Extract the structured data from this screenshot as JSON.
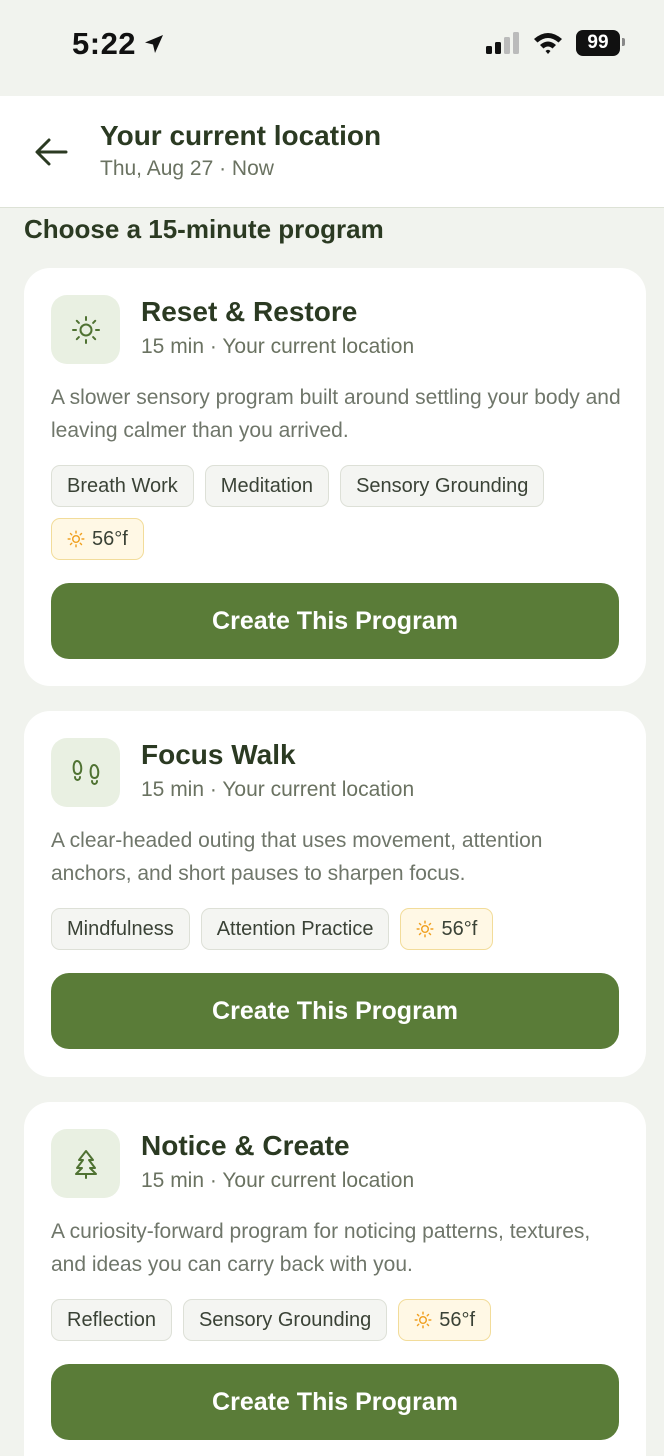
{
  "status_bar": {
    "time": "5:22",
    "battery": "99"
  },
  "header": {
    "title": "Your current location",
    "subtitle": "Thu, Aug 27 · Now"
  },
  "section_title": "Choose a 15-minute program",
  "colors": {
    "accent": "#5a7c38",
    "heading": "#2b3a22",
    "icon_bg": "#e9f0e2",
    "weather_tag_bg": "#fff8e5",
    "weather_icon": "#f0a020"
  },
  "programs": [
    {
      "icon": "sun-icon",
      "title": "Reset & Restore",
      "meta": "15 min · Your current location",
      "description": "A slower sensory program built around settling your body and leaving calmer than you arrived.",
      "tags": [
        "Breath Work",
        "Meditation",
        "Sensory Grounding"
      ],
      "weather": "56°f",
      "button": "Create This Program"
    },
    {
      "icon": "footprints-icon",
      "title": "Focus Walk",
      "meta": "15 min · Your current location",
      "description": "A clear-headed outing that uses movement, attention anchors, and short pauses to sharpen focus.",
      "tags": [
        "Mindfulness",
        "Attention Practice"
      ],
      "weather": "56°f",
      "button": "Create This Program"
    },
    {
      "icon": "tree-icon",
      "title": "Notice & Create",
      "meta": "15 min · Your current location",
      "description": "A curiosity-forward program for noticing patterns, textures, and ideas you can carry back with you.",
      "tags": [
        "Reflection",
        "Sensory Grounding"
      ],
      "weather": "56°f",
      "button": "Create This Program"
    }
  ]
}
